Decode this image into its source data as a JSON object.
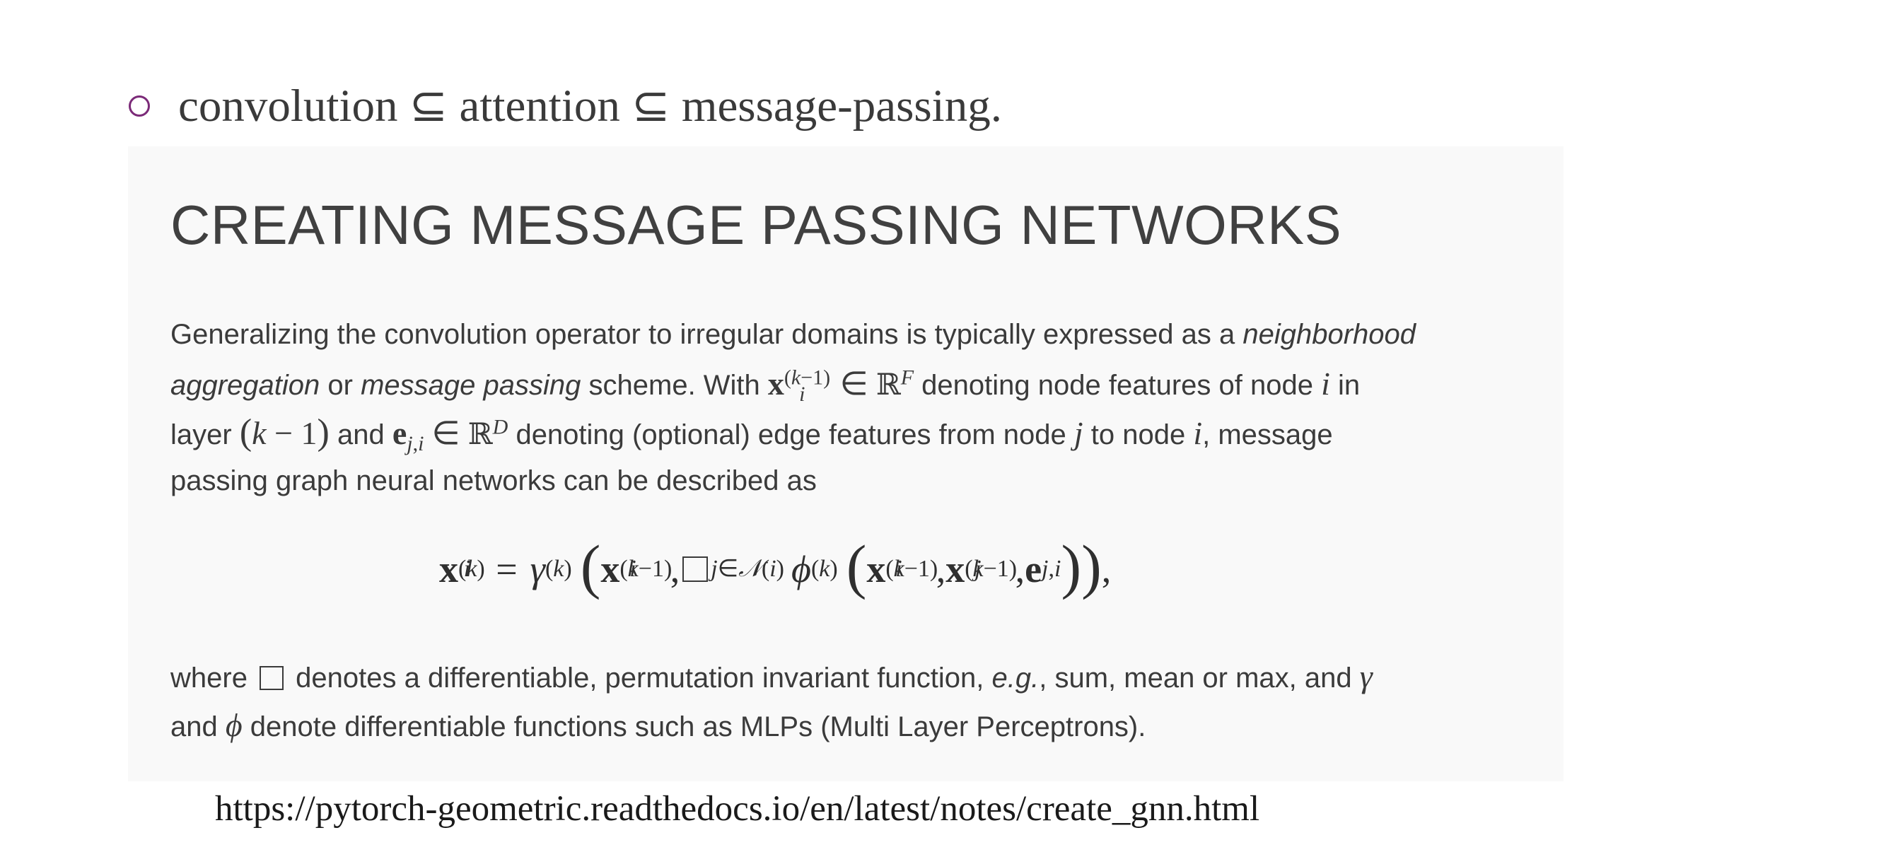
{
  "bullet": {
    "text": "convolution ⊆ attention ⊆ message-passing."
  },
  "card": {
    "title": "CREATING MESSAGE PASSING NETWORKS",
    "paragraph1": {
      "l1_a": "Generalizing the convolution operator to irregular domains is typically expressed as a ",
      "l1_it": "neighborhood",
      "l2_it1": "aggregation",
      "l2_a": " or ",
      "l2_it2": "message passing",
      "l2_b": " scheme. With ",
      "l2_c": " denoting node features of node ",
      "l2_d": " in",
      "l3_a": "layer ",
      "l3_b": " and ",
      "l3_c": " denoting (optional) edge features from node ",
      "l3_d": " to node ",
      "l3_e": ", message",
      "l4": "passing graph neural networks can be described as"
    },
    "paragraph2": {
      "l1_a": "where ",
      "l1_b": " denotes a differentiable, permutation invariant function, ",
      "l1_it": "e.g.",
      "l1_c": ", sum, mean or max, and ",
      "l2_a": "and ",
      "l2_b": " denote differentiable functions such as MLPs (Multi Layer Perceptrons)."
    }
  },
  "source": {
    "url": "https://pytorch-geometric.readthedocs.io/en/latest/notes/create_gnn.html"
  },
  "colors": {
    "bullet_marker": "#7b2a78",
    "card_background": "#f9f9f9",
    "text": "#3b3b3b"
  }
}
